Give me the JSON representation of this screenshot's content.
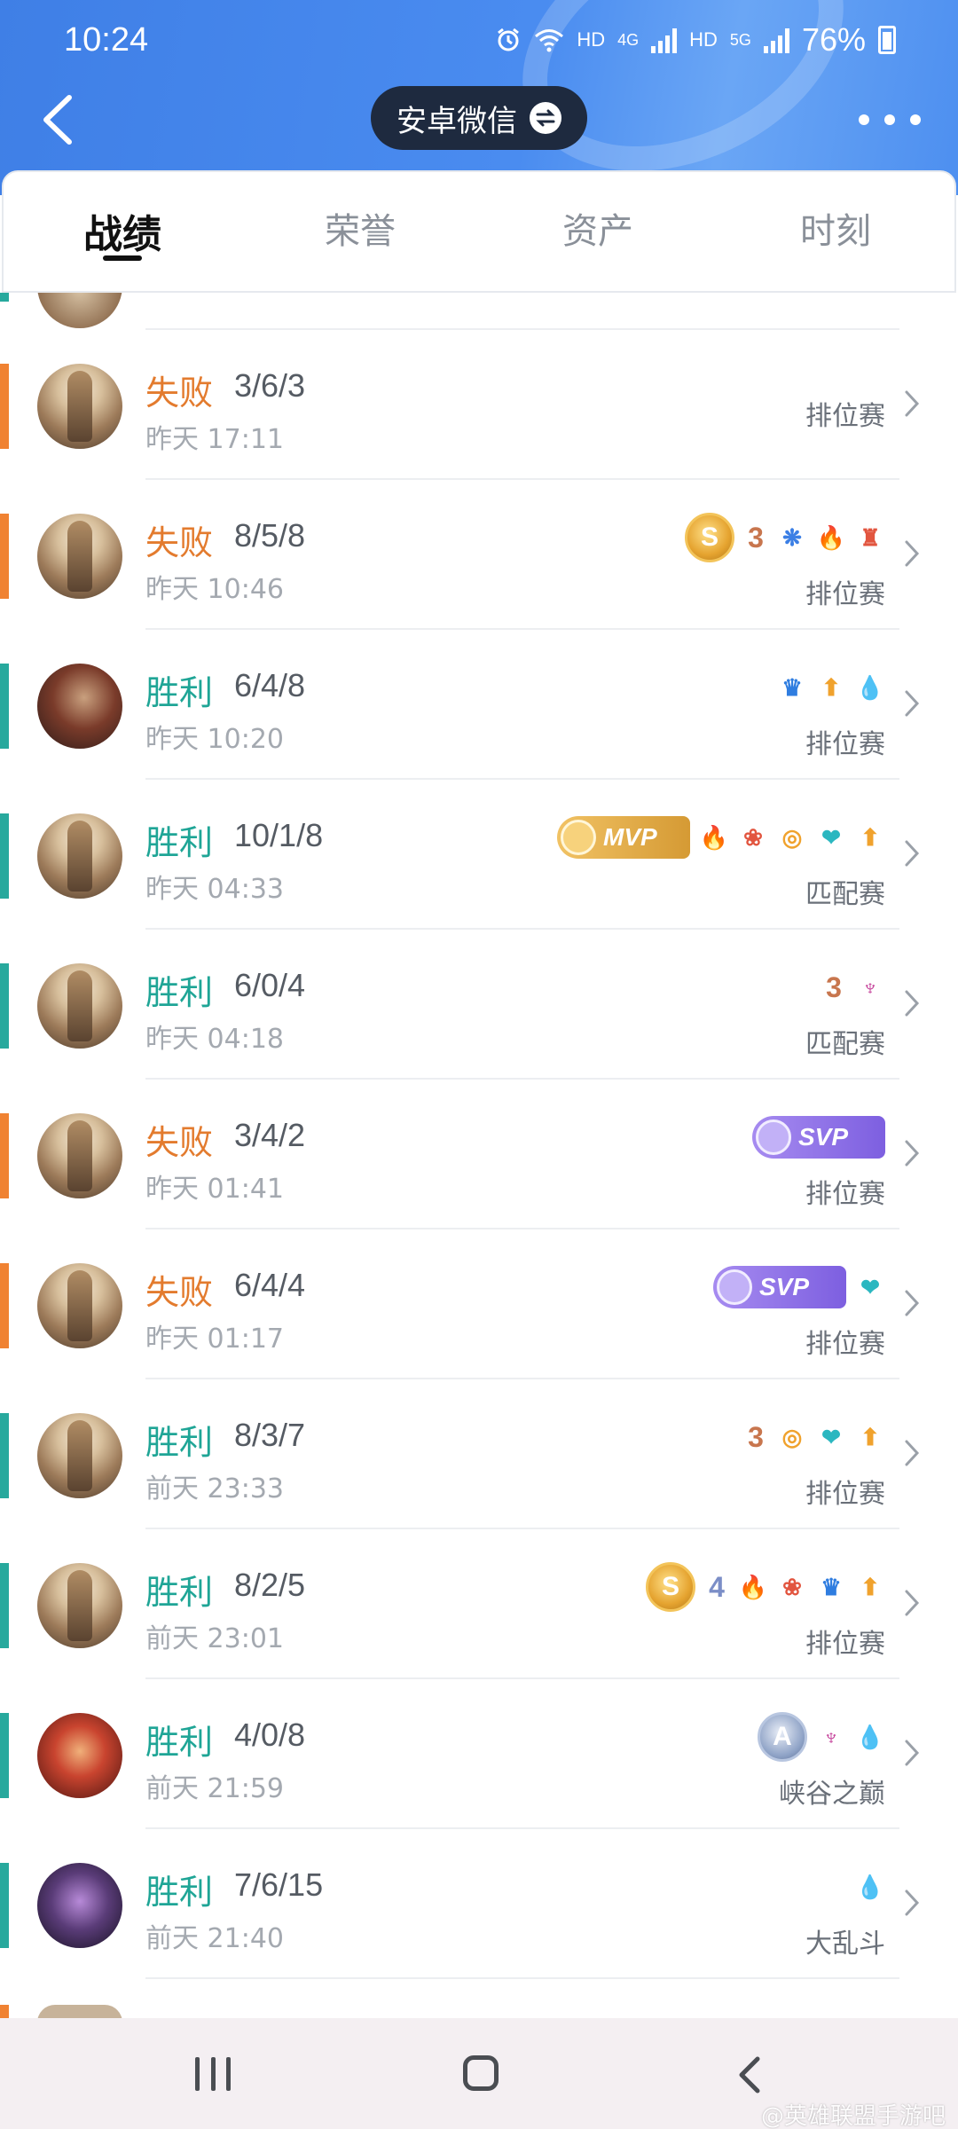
{
  "status_bar": {
    "time": "10:24",
    "battery": "76%",
    "net_1": "HD",
    "net_1_gen": "4G",
    "net_2": "HD",
    "net_2_gen": "5G",
    "icons": [
      "alarm-icon",
      "wifi-icon",
      "signal-icon",
      "battery-icon"
    ]
  },
  "header": {
    "account_label": "安卓微信",
    "back_icon": "back-arrow-icon",
    "switch_icon": "swap-icon",
    "more_icon": "more-dots-icon"
  },
  "tabs": [
    {
      "label": "战绩",
      "active": true
    },
    {
      "label": "荣誉",
      "active": false
    },
    {
      "label": "资产",
      "active": false
    },
    {
      "label": "时刻",
      "active": false
    }
  ],
  "matches": [
    {
      "result": "失败",
      "kda": "3/6/3",
      "time": "昨天 17:11",
      "mode": "排位赛",
      "outcome": "lose",
      "hero": "knight",
      "badges": []
    },
    {
      "result": "失败",
      "kda": "8/5/8",
      "time": "昨天 10:46",
      "mode": "排位赛",
      "outcome": "lose",
      "hero": "knight",
      "badges": [
        "S",
        "3",
        "swirl",
        "fire",
        "tower"
      ]
    },
    {
      "result": "胜利",
      "kda": "6/4/8",
      "time": "昨天 10:20",
      "mode": "排位赛",
      "outcome": "win",
      "hero": "warrior",
      "badges": [
        "crown",
        "arrow",
        "blood"
      ]
    },
    {
      "result": "胜利",
      "kda": "10/1/8",
      "time": "昨天 04:33",
      "mode": "匹配赛",
      "outcome": "win",
      "hero": "knight",
      "badges": [
        "MVP",
        "fire",
        "lotus",
        "coin",
        "heal",
        "arrow"
      ]
    },
    {
      "result": "胜利",
      "kda": "6/0/4",
      "time": "昨天 04:18",
      "mode": "匹配赛",
      "outcome": "win",
      "hero": "knight",
      "badges": [
        "3",
        "demon"
      ]
    },
    {
      "result": "失败",
      "kda": "3/4/2",
      "time": "昨天 01:41",
      "mode": "排位赛",
      "outcome": "lose",
      "hero": "knight",
      "badges": [
        "SVP"
      ]
    },
    {
      "result": "失败",
      "kda": "6/4/4",
      "time": "昨天 01:17",
      "mode": "排位赛",
      "outcome": "lose",
      "hero": "knight",
      "badges": [
        "SVP",
        "heal"
      ]
    },
    {
      "result": "胜利",
      "kda": "8/3/7",
      "time": "前天 23:33",
      "mode": "排位赛",
      "outcome": "win",
      "hero": "knight",
      "badges": [
        "3",
        "coin",
        "heal",
        "arrow"
      ]
    },
    {
      "result": "胜利",
      "kda": "8/2/5",
      "time": "前天 23:01",
      "mode": "排位赛",
      "outcome": "win",
      "hero": "knight",
      "badges": [
        "S",
        "4",
        "fire",
        "lotus",
        "crown",
        "arrow"
      ]
    },
    {
      "result": "胜利",
      "kda": "4/0/8",
      "time": "前天 21:59",
      "mode": "峡谷之巅",
      "outcome": "win",
      "hero": "monkey",
      "badges": [
        "A",
        "demon",
        "blood"
      ]
    },
    {
      "result": "胜利",
      "kda": "7/6/15",
      "time": "前天 21:40",
      "mode": "大乱斗",
      "outcome": "win",
      "hero": "dark",
      "badges": [
        "blood"
      ]
    }
  ],
  "colors": {
    "win": "#1fa596",
    "lose": "#e37b2e",
    "header_bg": "#4a8cf0",
    "pill_bg": "#1e2a3f"
  },
  "system_nav": {
    "recent_icon": "recent-apps-icon",
    "home_icon": "home-icon",
    "back_icon": "back-icon"
  },
  "watermark": "@英雄联盟手游吧"
}
